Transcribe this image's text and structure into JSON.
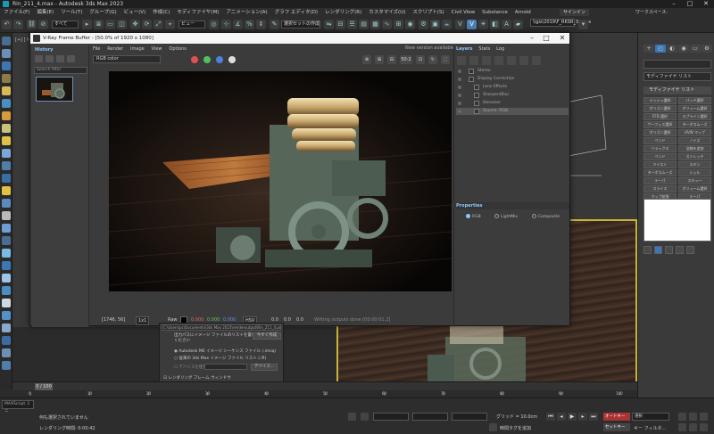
{
  "app": {
    "title": "Rin_211_4.max - Autodesk 3ds Max 2023",
    "controls": [
      "–",
      "□",
      "✕"
    ]
  },
  "menu": {
    "items": [
      "ファイル(F)",
      "編集(E)",
      "ツール(T)",
      "グループ(G)",
      "ビュー(V)",
      "作成(C)",
      "モディファイヤ(M)",
      "アニメーション(A)",
      "グラフ エディタ(D)",
      "レンダリング(R)",
      "カスタマイズ(U)",
      "スクリプト(S)",
      "Civil View",
      "Substance",
      "Arnold"
    ],
    "sign_in": "サインイン",
    "workspace_label": "ワークスペース:"
  },
  "toolbar": {
    "filter_dd": "すべて",
    "view_dd": "ビュー",
    "selection_set_dd": "選択セットの作成",
    "workspace_path": "\\\\giz\\2019\\F_RKSR_3dmax"
  },
  "viewport": {
    "label": "[+] [トップ] [標準] [ワイヤフレーム]"
  },
  "command_panel": {
    "tabs": [
      "+",
      "◰",
      "◐",
      "◉",
      "▭",
      "⚙"
    ],
    "modifier_list_label": "モディファイヤ リスト",
    "section_label": "モディファイヤ リスト",
    "buttons": [
      "メッシュ選択",
      "パッチ選択",
      "ポリゴン選択",
      "ボリューム選択",
      "FFD 選択",
      "スプライン選択",
      "サーフェス選択",
      "ターボスムーズ",
      "ポリゴン選択",
      "UVW マップ",
      "ベンド",
      "ノイズ",
      "リラックス",
      "法線を追加",
      "ベンド",
      "ストレッチ",
      "ツイスト",
      "スキン",
      "ターボスムーズ",
      "シェル",
      "テーパ",
      "スキュー",
      "スライス",
      "ボリューム選択",
      "マップ拡張",
      "テーパ",
      "ラッティス",
      "押し出し",
      "ラップ"
    ]
  },
  "vfb": {
    "title": "V-Ray Frame Buffer - [50.0% of 1920 x 1080]",
    "menu": [
      "File",
      "Render",
      "Image",
      "View",
      "Options"
    ],
    "new_version": "New version available!",
    "history_title": "History",
    "search_placeholder": "Search filter",
    "channel": "RGB color",
    "toolbar_icons": [
      "⊕",
      "⊞",
      "⊟",
      "50:2",
      "⊡",
      "↻",
      "⬚",
      "⟳",
      "✦",
      "⊘"
    ],
    "layers_tabs": [
      "Layers",
      "Stats",
      "Log"
    ],
    "layers": [
      "Stereo",
      "Display Correction",
      "Lens Effects",
      "Sharpen/Blur",
      "Denoiser",
      "Source: RGB"
    ],
    "properties_title": "Properties",
    "properties_options": [
      "RGB",
      "LightMix",
      "Composite"
    ],
    "status": {
      "coords": "[1746, 56]",
      "zoom": "1x1",
      "raw_label": "Raw",
      "r": "0.000",
      "g": "0.000",
      "b": "0.000",
      "color_space": "HSV",
      "v1": "0.0",
      "v2": "0.0",
      "v3": "0.0",
      "message": "Writing outputs done [00:00:01.2]"
    }
  },
  "render_settings": {
    "title": "レンダリング設定: V-Ray 6, update 2.0",
    "path": "C:\\Users\\pc\\Documents\\3ds Max 2023\\renderoutput\\Rin_211_4.png",
    "output_label": "出力パスにイメージ ファイルのリストを置いて",
    "output_label2": "ください",
    "create_now": "今すぐ作成",
    "option1": "Autodesk ME イメージ シーケンス ファイル (.imsq)",
    "option2": "従来の 3ds Max イメージ ファイル リスト (.ifl)",
    "device_label": "デバイスを使用",
    "device_btn": "デバイス...",
    "check1": "レンダリング フレーム ウィンドウ",
    "check2": "既存のイメージをスキップ",
    "rollouts": [
      "Eメールによる通知",
      "スクリプト",
      "レンダリングを割り当て"
    ]
  },
  "timeline": {
    "slider": "0 / 100",
    "ticks": [
      "0",
      "10",
      "20",
      "30",
      "40",
      "50",
      "60",
      "70",
      "80",
      "90",
      "100"
    ]
  },
  "status_bar": {
    "maxscript": "MAXScript ミニ",
    "selection_msg": "何も選択されていません",
    "render_time": "レンダリング時間: 0:00:42",
    "grid": "グリッド = 10.0cm",
    "add_time_tag": "時間タグを追加",
    "autokey": "オートキー",
    "setkey": "セットキー",
    "selected_dd": "選択",
    "key_filters": "キー フィルタ..."
  }
}
